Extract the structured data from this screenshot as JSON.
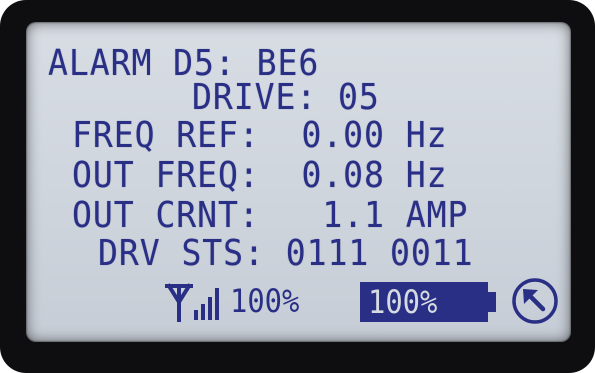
{
  "display": {
    "alarm": "ALARM D5: BE6",
    "drive": "DRIVE: 05",
    "freq_ref": "FREQ REF:  0.00 Hz",
    "out_freq": "OUT FREQ:  0.08 Hz",
    "out_crnt": "OUT CRNT:   1.1 AMP",
    "drv_sts": "DRV STS: 0111 0011"
  },
  "status": {
    "signal": "100%",
    "signal_level": 1.0,
    "battery": "100%",
    "battery_level": 1.0,
    "signal_icon": "antenna-signal-icon",
    "battery_icon": "battery-icon",
    "nav_icon": "arrow-up-left-circle-icon"
  },
  "colors": {
    "lcd_text": "#2a2f86",
    "lcd_background": "#d2d7df",
    "bezel": "#0e0e10"
  }
}
